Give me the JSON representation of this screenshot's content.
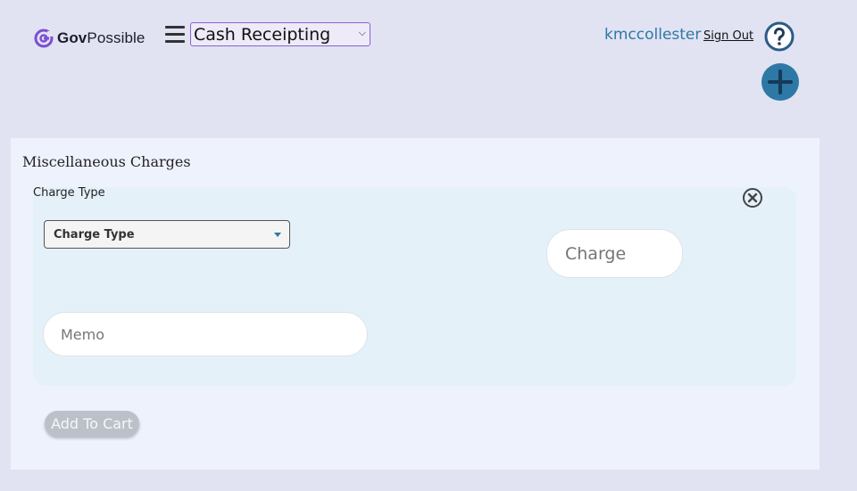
{
  "header": {
    "logo_prefix": "Gov",
    "logo_suffix": "Possible",
    "module_select_value": "Cash Receipting",
    "username": "kmccollester",
    "signout_label": "Sign Out"
  },
  "panel": {
    "title": "Miscellaneous Charges",
    "card": {
      "label": "Charge Type",
      "charge_type_value": "Charge Type",
      "charge_placeholder": "Charge",
      "memo_placeholder": "Memo"
    },
    "add_to_cart_label": "Add To Cart"
  },
  "icons": {
    "logo": "govpossible-logo-icon",
    "menu": "hamburger-menu-icon",
    "help": "question-circle-icon",
    "add": "plus-circle-icon",
    "close": "close-circle-icon"
  },
  "colors": {
    "accent": "#2e78a6",
    "brand": "#7b4fd0",
    "background": "#e1e3f3"
  }
}
